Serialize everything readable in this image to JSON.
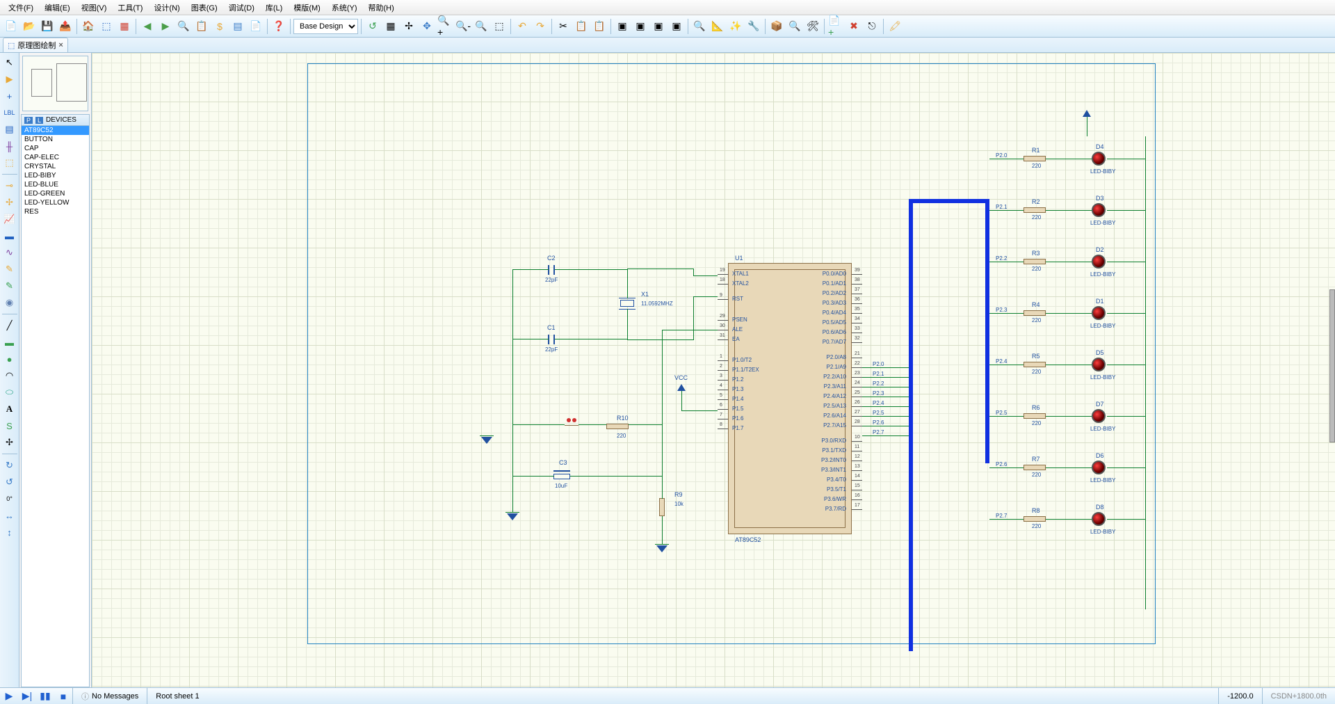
{
  "menu": {
    "file": "文件(F)",
    "edit": "编辑(E)",
    "view": "视图(V)",
    "tool": "工具(T)",
    "design": "设计(N)",
    "graph": "图表(G)",
    "debug": "调试(D)",
    "lib": "库(L)",
    "tmpl": "模版(M)",
    "sys": "系统(Y)",
    "help": "帮助(H)"
  },
  "toolbar": {
    "combo": "Base Design"
  },
  "tab": {
    "title": "原理图绘制"
  },
  "devices": {
    "header": "DEVICES",
    "items": [
      "AT89C52",
      "BUTTON",
      "CAP",
      "CAP-ELEC",
      "CRYSTAL",
      "LED-BIBY",
      "LED-BLUE",
      "LED-GREEN",
      "LED-YELLOW",
      "RES"
    ]
  },
  "chip": {
    "ref": "U1",
    "val": "AT89C52",
    "left_pins": [
      {
        "n": "19",
        "l": "XTAL1"
      },
      {
        "n": "18",
        "l": "XTAL2"
      },
      {
        "n": "",
        "l": ""
      },
      {
        "n": "9",
        "l": "RST"
      },
      {
        "n": "",
        "l": ""
      },
      {
        "n": "",
        "l": ""
      },
      {
        "n": "29",
        "l": "PSEN"
      },
      {
        "n": "30",
        "l": "ALE"
      },
      {
        "n": "31",
        "l": "EA"
      },
      {
        "n": "",
        "l": ""
      },
      {
        "n": "",
        "l": ""
      },
      {
        "n": "1",
        "l": "P1.0/T2"
      },
      {
        "n": "2",
        "l": "P1.1/T2EX"
      },
      {
        "n": "3",
        "l": "P1.2"
      },
      {
        "n": "4",
        "l": "P1.3"
      },
      {
        "n": "5",
        "l": "P1.4"
      },
      {
        "n": "6",
        "l": "P1.5"
      },
      {
        "n": "7",
        "l": "P1.6"
      },
      {
        "n": "8",
        "l": "P1.7"
      }
    ],
    "right_pins": [
      {
        "n": "39",
        "l": "P0.0/AD0"
      },
      {
        "n": "38",
        "l": "P0.1/AD1"
      },
      {
        "n": "37",
        "l": "P0.2/AD2"
      },
      {
        "n": "36",
        "l": "P0.3/AD3"
      },
      {
        "n": "35",
        "l": "P0.4/AD4"
      },
      {
        "n": "34",
        "l": "P0.5/AD5"
      },
      {
        "n": "33",
        "l": "P0.6/AD6"
      },
      {
        "n": "32",
        "l": "P0.7/AD7"
      },
      {
        "n": "",
        "l": ""
      },
      {
        "n": "21",
        "l": "P2.0/A8"
      },
      {
        "n": "22",
        "l": "P2.1/A9"
      },
      {
        "n": "23",
        "l": "P2.2/A10"
      },
      {
        "n": "24",
        "l": "P2.3/A11"
      },
      {
        "n": "25",
        "l": "P2.4/A12"
      },
      {
        "n": "26",
        "l": "P2.5/A13"
      },
      {
        "n": "27",
        "l": "P2.6/A14"
      },
      {
        "n": "28",
        "l": "P2.7/A15"
      },
      {
        "n": "",
        "l": ""
      },
      {
        "n": "10",
        "l": "P3.0/RXD"
      },
      {
        "n": "11",
        "l": "P3.1/TXD"
      },
      {
        "n": "12",
        "l": "P3.2/INT0"
      },
      {
        "n": "13",
        "l": "P3.3/INT1"
      },
      {
        "n": "14",
        "l": "P3.4/T0"
      },
      {
        "n": "15",
        "l": "P3.5/T1"
      },
      {
        "n": "16",
        "l": "P3.6/WR"
      },
      {
        "n": "17",
        "l": "P3.7/RD"
      }
    ]
  },
  "bus_labels": [
    "P2.0",
    "P2.1",
    "P2.2",
    "P2.3",
    "P2.4",
    "P2.5",
    "P2.6",
    "P2.7"
  ],
  "caps": [
    {
      "ref": "C2",
      "val": "22pF"
    },
    {
      "ref": "C1",
      "val": "22pF"
    },
    {
      "ref": "C3",
      "val": "10uF"
    }
  ],
  "xtal": {
    "ref": "X1",
    "val": "11.0592MHZ"
  },
  "resistors": [
    {
      "ref": "R10",
      "val": "220"
    },
    {
      "ref": "R9",
      "val": "10k"
    }
  ],
  "led_rows": [
    {
      "net": "P2.0",
      "r": "R1",
      "rv": "220",
      "d": "D4",
      "dv": "LED-BIBY"
    },
    {
      "net": "P2.1",
      "r": "R2",
      "rv": "220",
      "d": "D3",
      "dv": "LED-BIBY"
    },
    {
      "net": "P2.2",
      "r": "R3",
      "rv": "220",
      "d": "D2",
      "dv": "LED-BIBY"
    },
    {
      "net": "P2.3",
      "r": "R4",
      "rv": "220",
      "d": "D1",
      "dv": "LED-BIBY"
    },
    {
      "net": "P2.4",
      "r": "R5",
      "rv": "220",
      "d": "D5",
      "dv": "LED-BIBY"
    },
    {
      "net": "P2.5",
      "r": "R6",
      "rv": "220",
      "d": "D7",
      "dv": "LED-BIBY"
    },
    {
      "net": "P2.6",
      "r": "R7",
      "rv": "220",
      "d": "D6",
      "dv": "LED-BIBY"
    },
    {
      "net": "P2.7",
      "r": "R8",
      "rv": "220",
      "d": "D8",
      "dv": "LED-BIBY"
    }
  ],
  "vcc": "VCC",
  "status": {
    "msg": "No Messages",
    "sheet": "Root sheet 1",
    "x": "-1200.0",
    "y": "+1800.0",
    "hint": "th"
  }
}
